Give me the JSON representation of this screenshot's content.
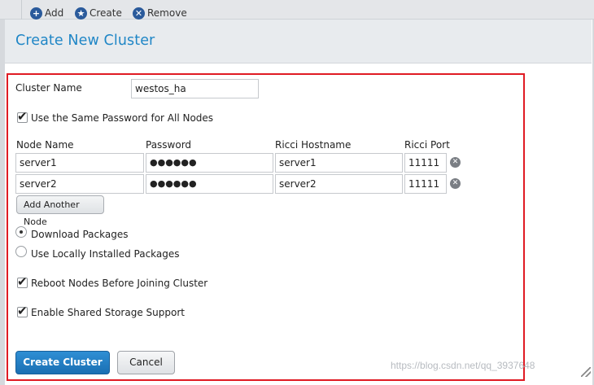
{
  "toolbar": {
    "add_label": "Add",
    "create_label": "Create",
    "remove_label": "Remove",
    "add_icon": "+",
    "create_icon": "★",
    "remove_icon": "✕"
  },
  "dialog": {
    "title": "Create New Cluster"
  },
  "form": {
    "cluster_name_label": "Cluster Name",
    "cluster_name_value": "westos_ha",
    "same_password_label": "Use the Same Password for All Nodes",
    "same_password_checked": true,
    "columns": {
      "node_name": "Node Name",
      "password": "Password",
      "ricci_hostname": "Ricci Hostname",
      "ricci_port": "Ricci Port"
    },
    "nodes": [
      {
        "node_name": "server1",
        "password": "●●●●●●",
        "ricci_hostname": "server1",
        "ricci_port": "11111"
      },
      {
        "node_name": "server2",
        "password": "●●●●●●",
        "ricci_hostname": "server2",
        "ricci_port": "11111"
      }
    ],
    "add_node_label": "Add Another Node",
    "download_packages_label": "Download Packages",
    "download_packages_selected": true,
    "local_packages_label": "Use Locally Installed Packages",
    "reboot_label": "Reboot Nodes Before Joining Cluster",
    "reboot_checked": true,
    "shared_storage_label": "Enable Shared Storage Support",
    "shared_storage_checked": true
  },
  "buttons": {
    "create": "Create Cluster",
    "cancel": "Cancel"
  },
  "watermark": "https://blog.csdn.net/qq_3937648",
  "colors": {
    "title": "#1f86c6",
    "primary": "#1a6fb3",
    "highlight": "#e01b24"
  }
}
